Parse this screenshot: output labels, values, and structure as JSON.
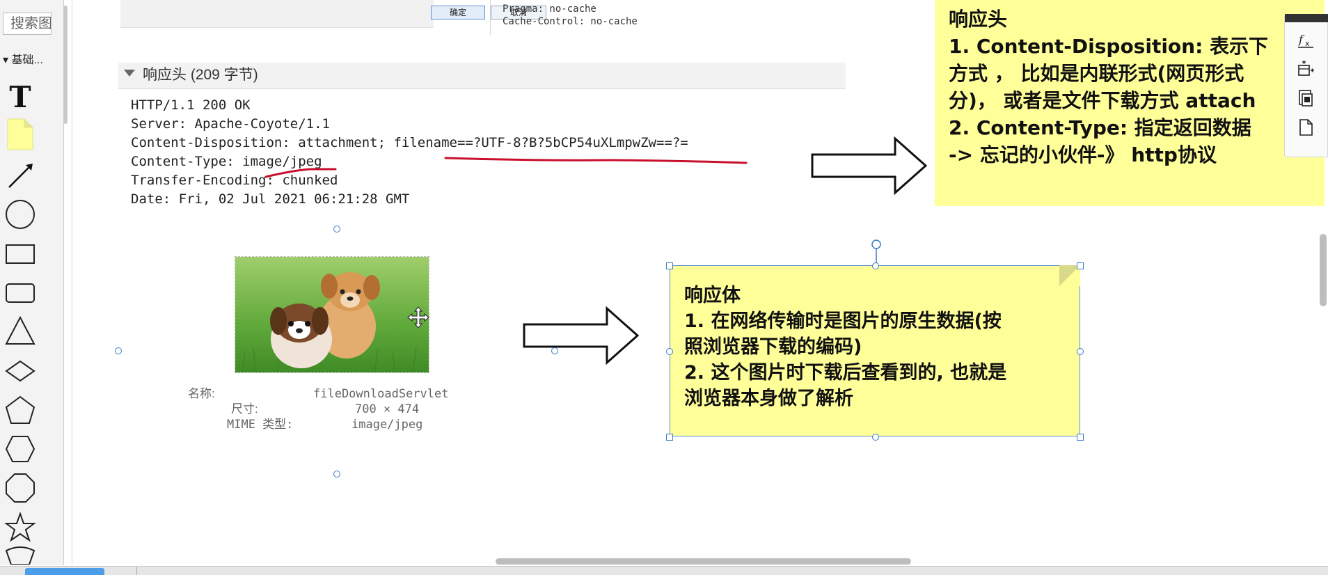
{
  "sidebar": {
    "search_text": "搜索图形",
    "category": "▾ 基础..."
  },
  "dialog": {
    "ok_label": "确定",
    "cancel_label": "取消"
  },
  "request_headers": {
    "lines": [
      "Pragma: no-cache",
      "Cache-Control: no-cache"
    ]
  },
  "response_header_section": {
    "title": "响应头 (209 字节)",
    "lines": [
      "HTTP/1.1 200 OK",
      "Server: Apache-Coyote/1.1",
      "Content-Disposition: attachment; filename==?UTF-8?B?5bCP54uXLmpwZw==?=",
      "Content-Type: image/jpeg",
      "Transfer-Encoding: chunked",
      "Date: Fri, 02 Jul 2021 06:21:28 GMT"
    ]
  },
  "image_info": {
    "name_label": "名称:",
    "name_value": "fileDownloadServlet",
    "size_label": "尺寸:",
    "size_value": "700 × 474",
    "mime_label": "MIME 类型:",
    "mime_value": "image/jpeg"
  },
  "note_top": {
    "lines": [
      "响应头",
      "1. Content-Disposition: 表示下",
      "方式 ， 比如是内联形式(网页形式",
      "分)， 或者是文件下载方式 attach",
      "2. Content-Type: 指定返回数据",
      "-> 忘记的小伙伴-》 http协议"
    ]
  },
  "note_body": {
    "lines": [
      "响应体",
      "1. 在网络传输时是图片的原生数据(按",
      "照浏览器下载的编码)",
      "2. 这个图片时下载后查看到的, 也就是",
      "浏览器本身做了解析"
    ]
  },
  "icons": {
    "tools": [
      "text-tool-icon",
      "note-tool-icon",
      "arrow-line-tool-icon",
      "circle-tool-icon",
      "rectangle-tool-icon",
      "rounded-rectangle-tool-icon",
      "triangle-tool-icon",
      "diamond-tool-icon",
      "pentagon-tool-icon",
      "hexagon-tool-icon",
      "octagon-tool-icon",
      "star-tool-icon",
      "shield-tool-icon"
    ],
    "mini_toolbar": [
      "formula-icon",
      "table-insert-icon",
      "copy-page-icon",
      "blank-page-icon"
    ]
  },
  "colors": {
    "note_fill": "#ffff99",
    "selection_blue": "#3a7bc8",
    "annotation_red": "#c8102e"
  }
}
